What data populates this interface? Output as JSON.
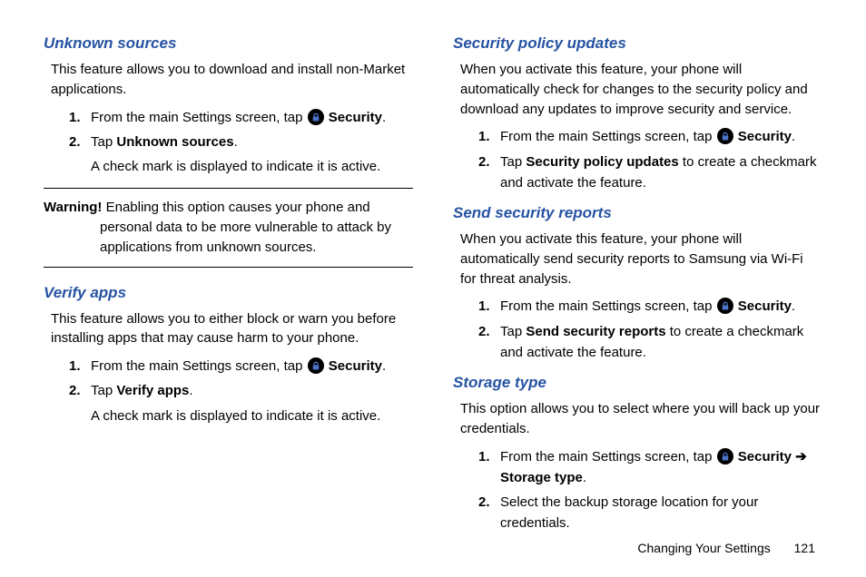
{
  "left": {
    "unknownSources": {
      "heading": "Unknown sources",
      "intro": "This feature allows you to download and install non-Market applications.",
      "step1_a": "From the main Settings screen, tap ",
      "step1_b": " Security",
      "step1_c": ".",
      "step2_a": "Tap ",
      "step2_b": "Unknown sources",
      "step2_c": ".",
      "step2_sub": "A check mark is displayed to indicate it is active."
    },
    "warning": {
      "prefix": "Warning! ",
      "body": "Enabling this option causes your phone and personal data to be more vulnerable to attack by applications from unknown sources."
    },
    "verifyApps": {
      "heading": "Verify apps",
      "intro": "This feature allows you to either block or warn you before installing apps that may cause harm to your phone.",
      "step1_a": "From the main Settings screen, tap ",
      "step1_b": " Security",
      "step1_c": ".",
      "step2_a": "Tap ",
      "step2_b": "Verify apps",
      "step2_c": ".",
      "step2_sub": "A check mark is displayed to indicate it is active."
    }
  },
  "right": {
    "securityPolicy": {
      "heading": "Security policy updates",
      "intro": "When you activate this feature, your phone will automatically check for changes to the security policy and download any updates to improve security and service.",
      "step1_a": "From the main Settings screen, tap ",
      "step1_b": " Security",
      "step1_c": ".",
      "step2_a": "Tap ",
      "step2_b": "Security policy updates",
      "step2_c": " to create a checkmark and activate the feature."
    },
    "sendReports": {
      "heading": "Send security reports",
      "intro": "When you activate this feature, your phone will automatically send security reports to Samsung via Wi-Fi for threat analysis.",
      "step1_a": "From the main Settings screen, tap ",
      "step1_b": " Security",
      "step1_c": ".",
      "step2_a": "Tap ",
      "step2_b": "Send security reports",
      "step2_c": " to create a checkmark and activate the feature."
    },
    "storageType": {
      "heading": "Storage type",
      "intro": "This option allows you to select where you will back up your credentials.",
      "step1_a": "From the main Settings screen, tap ",
      "step1_b": " Security ",
      "step1_arrow": "➔",
      "step1_c": " Storage type",
      "step1_d": ".",
      "step2": "Select the backup storage location for your credentials."
    }
  },
  "footer": {
    "label": "Changing Your Settings",
    "page": "121"
  }
}
